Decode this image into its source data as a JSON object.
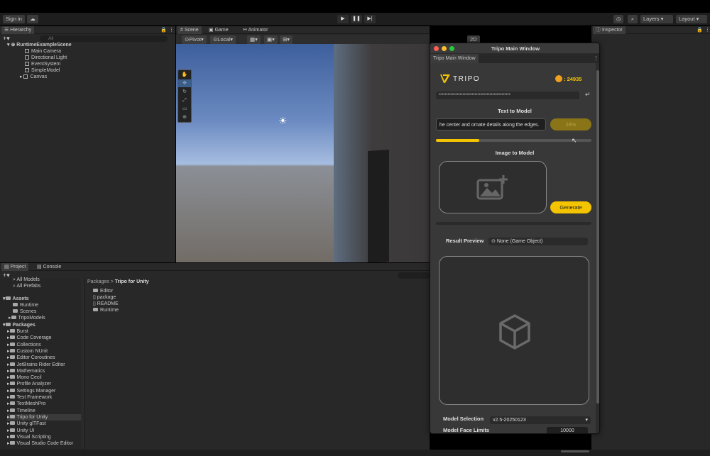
{
  "toolbar": {
    "sign_in": "Sign in",
    "layers": "Layers",
    "layout": "Layout"
  },
  "hierarchy": {
    "tab": "Hierarchy",
    "search_placeholder": "All",
    "scene_name": "RuntimeExampleScene",
    "items": [
      "Main Camera",
      "Directional Light",
      "EventSystem",
      "SimpleModel",
      "Canvas"
    ]
  },
  "scene": {
    "tabs": [
      "Scene",
      "Game",
      "Animator"
    ],
    "pivot": "Pivot",
    "local": "Local",
    "mode_2d": "2D"
  },
  "inspector": {
    "tab": "Inspector"
  },
  "project": {
    "tabs": [
      "Project",
      "Console"
    ],
    "favorites": [
      "All Models",
      "All Prefabs"
    ],
    "assets_label": "Assets",
    "assets": [
      "Runtime",
      "Scenes",
      "TripoModels"
    ],
    "packages_label": "Packages",
    "packages": [
      "Burst",
      "Code Coverage",
      "Collections",
      "Custom NUnit",
      "Editor Coroutines",
      "JetBrains Rider Editor",
      "Mathematics",
      "Mono Cecil",
      "Profile Analyzer",
      "Settings Manager",
      "Test Framework",
      "TextMeshPro",
      "Timeline",
      "Tripo for Unity",
      "Unity glTFast",
      "Unity UI",
      "Visual Scripting",
      "Visual Studio Code Editor"
    ],
    "selected_package": "Tripo for Unity",
    "breadcrumb_root": "Packages",
    "breadcrumb_sep": ">",
    "breadcrumb_current": "Tripo for Unity",
    "files": [
      "Editor",
      "package",
      "README",
      "Runtime"
    ]
  },
  "tripo": {
    "window_title": "Tripo Main Window",
    "tab": "Tripo Main Window",
    "logo_text": "TRIPO",
    "credits": ": 24935",
    "api_key_masked": "••••••••••••••••••••••••••••••••••••••••••••••••",
    "text_to_model_title": "Text to Model",
    "prompt_value": "he center and ornate details along the edges.",
    "progress_label": "28%",
    "progress_fraction": 0.28,
    "image_to_model_title": "Image to Model",
    "generate_label": "Generate",
    "result_preview_label": "Result Preview",
    "result_object": "None (Game Object)",
    "model_selection_label": "Model Selection",
    "model_selection_value": "v2.5-20250123",
    "model_face_limits_label": "Model Face Limits",
    "model_face_limits_value": "10000",
    "accent_color": "#f5c400"
  }
}
